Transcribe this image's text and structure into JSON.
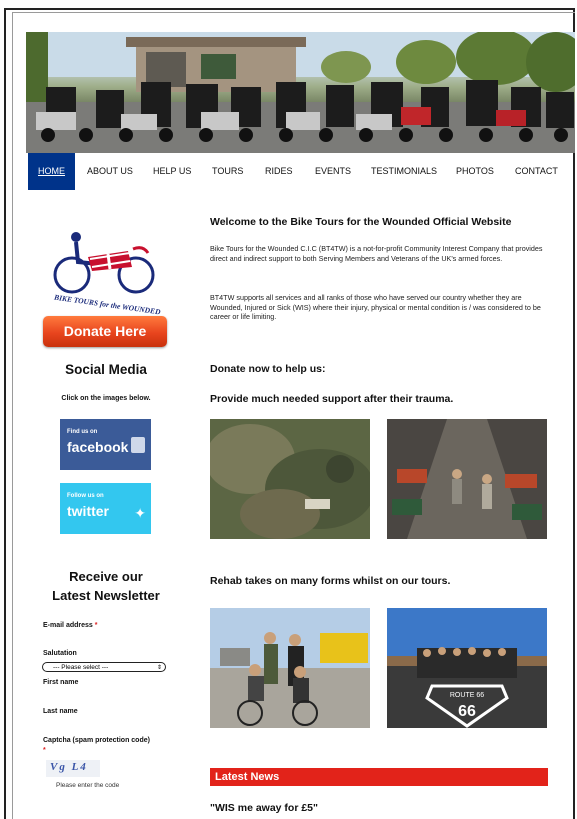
{
  "nav": {
    "items": [
      "HOME",
      "ABOUT US",
      "HELP US",
      "TOURS",
      "RIDES",
      "EVENTS",
      "TESTIMONIALS",
      "PHOTOS",
      "CONTACT"
    ],
    "active": "HOME"
  },
  "sidebar": {
    "logo_text": "BIKE TOURS for the WOUNDED",
    "donate_label": "Donate Here",
    "social_heading": "Social Media",
    "social_sub": "Click on the images below.",
    "facebook_small": "Find us on",
    "facebook_big": "facebook",
    "twitter_small": "Follow us on",
    "twitter_big": "twitter",
    "newsletter_heading_1": "Receive our",
    "newsletter_heading_2": "Latest Newsletter",
    "email_label": "E-mail address",
    "salutation_label": "Salutation",
    "salutation_value": "--- Please select ---",
    "first_name_label": "First name",
    "last_name_label": "Last name",
    "captcha_label": "Captcha (spam protection code)",
    "captcha_text": "Vg L4",
    "captcha_hint": "Please enter the code",
    "required_mark": "*"
  },
  "main": {
    "welcome_title": "Welcome to the Bike Tours for the Wounded Official Website",
    "para1": "Bike Tours for the Wounded C.I.C (BT4TW) is a not-for-profit Community Interest Company that provides direct and indirect support to both Serving Members and Veterans of the UK's armed forces.",
    "para2": "BT4TW supports all services and all ranks of those who have served our country whether they are Wounded, Injured or Sick (WIS) where their injury, physical or mental condition is / was considered to be career or life limiting.",
    "donate_heading": "Donate now to help us:",
    "support_heading": "Provide much needed support after their trauma.",
    "rehab_heading": "Rehab takes on many forms whilst on our tours.",
    "route66_text": "ROUTE 66",
    "news_bar": "Latest News",
    "news_title": "\"WIS me away for £5\""
  },
  "colors": {
    "nav_active": "#00338a",
    "donate_button": "#e8451e",
    "facebook": "#3b5b98",
    "twitter": "#33c7ef",
    "news_bar": "#e2231a"
  }
}
